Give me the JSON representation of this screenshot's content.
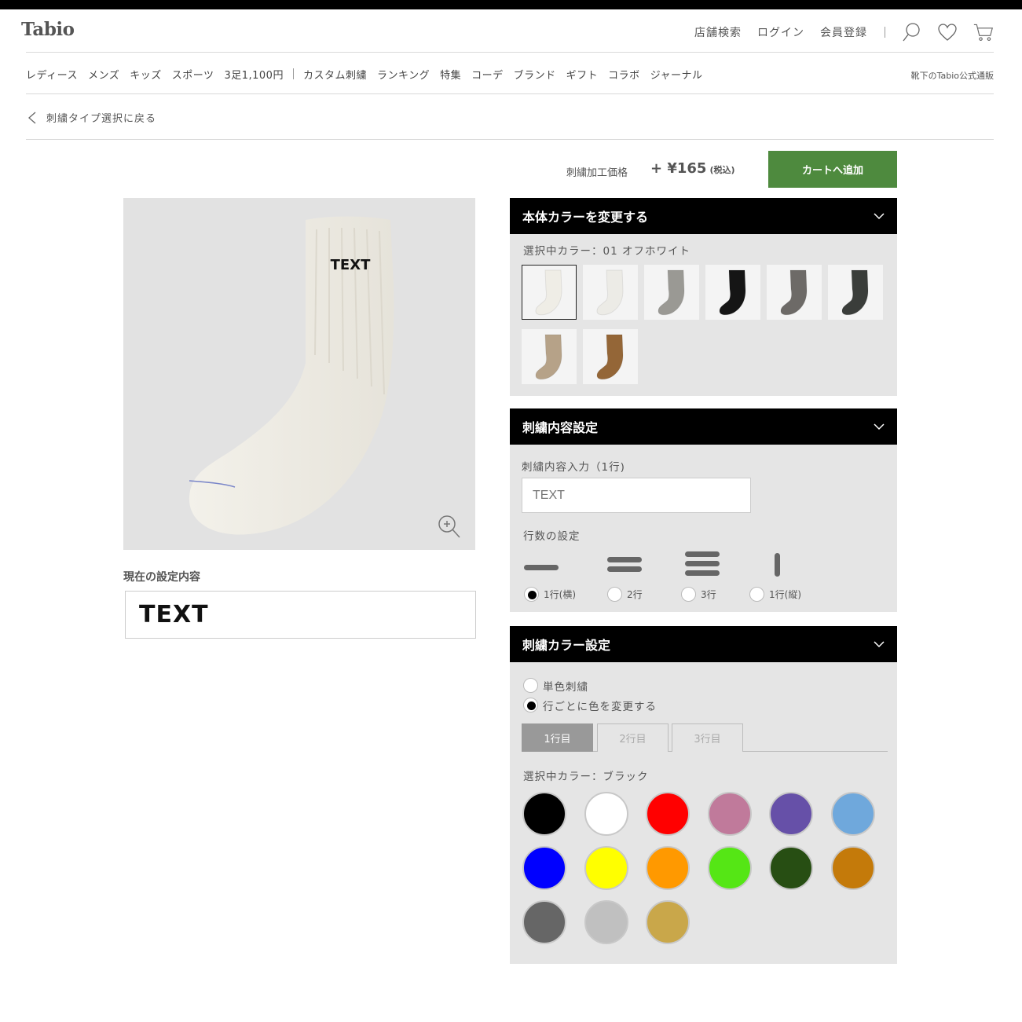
{
  "header": {
    "logo": "Tabio",
    "links": [
      "店舗検索",
      "ログイン",
      "会員登録"
    ],
    "icons": [
      "search-icon",
      "heart-icon",
      "cart-icon"
    ]
  },
  "nav": {
    "items_before_sep": [
      "レディース",
      "メンズ",
      "キッズ",
      "スポーツ",
      "3足1,100円"
    ],
    "items_after_sep": [
      "カスタム刺繍",
      "ランキング",
      "特集",
      "コーデ",
      "ブランド",
      "ギフト",
      "コラボ",
      "ジャーナル"
    ],
    "right_text": "靴下のTabio公式通販"
  },
  "back_link": "刺繍タイプ選択に戻る",
  "price": {
    "label": "刺繍加工価格",
    "value": "+ ¥165",
    "tax": "(税込)"
  },
  "cart_button": "カートへ追加",
  "preview": {
    "sock_text": "TEXT",
    "current_label": "現在の設定内容",
    "current_text": "TEXT"
  },
  "body_color": {
    "title": "本体カラーを変更する",
    "selected_label": "選択中カラー：01 オフホワイト",
    "swatches": [
      {
        "color": "#efede6",
        "selected": true
      },
      {
        "color": "#ecebe6",
        "selected": false
      },
      {
        "color": "#9a9994",
        "selected": false
      },
      {
        "color": "#151515",
        "selected": false
      },
      {
        "color": "#6d6a67",
        "selected": false
      },
      {
        "color": "#3a3d3a",
        "selected": false
      },
      {
        "color": "#b6a288",
        "selected": false
      },
      {
        "color": "#946637",
        "selected": false
      }
    ]
  },
  "embroidery": {
    "title": "刺繍内容設定",
    "input_label": "刺繍内容入力（1行)",
    "input_placeholder": "TEXT",
    "lines_label": "行数の設定",
    "line_options": [
      {
        "label": "1行(横)",
        "checked": true
      },
      {
        "label": "2行",
        "checked": false
      },
      {
        "label": "3行",
        "checked": false
      },
      {
        "label": "1行(縦)",
        "checked": false
      }
    ]
  },
  "thread_color": {
    "title": "刺繍カラー設定",
    "mode_options": [
      {
        "label": "単色刺繍",
        "checked": false
      },
      {
        "label": "行ごとに色を変更する",
        "checked": true
      }
    ],
    "tabs": [
      {
        "label": "1行目",
        "active": true
      },
      {
        "label": "2行目",
        "active": false
      },
      {
        "label": "3行目",
        "active": false
      }
    ],
    "selected_label": "選択中カラー：ブラック",
    "colors": [
      "#000000",
      "#ffffff",
      "#ff0000",
      "#c07a9b",
      "#6650a8",
      "#6fa8dc",
      "#0000ff",
      "#ffff00",
      "#ff9900",
      "#55e615",
      "#274e13",
      "#c47a0a",
      "#666666",
      "#c0c0c0",
      "#c9a74a"
    ]
  }
}
